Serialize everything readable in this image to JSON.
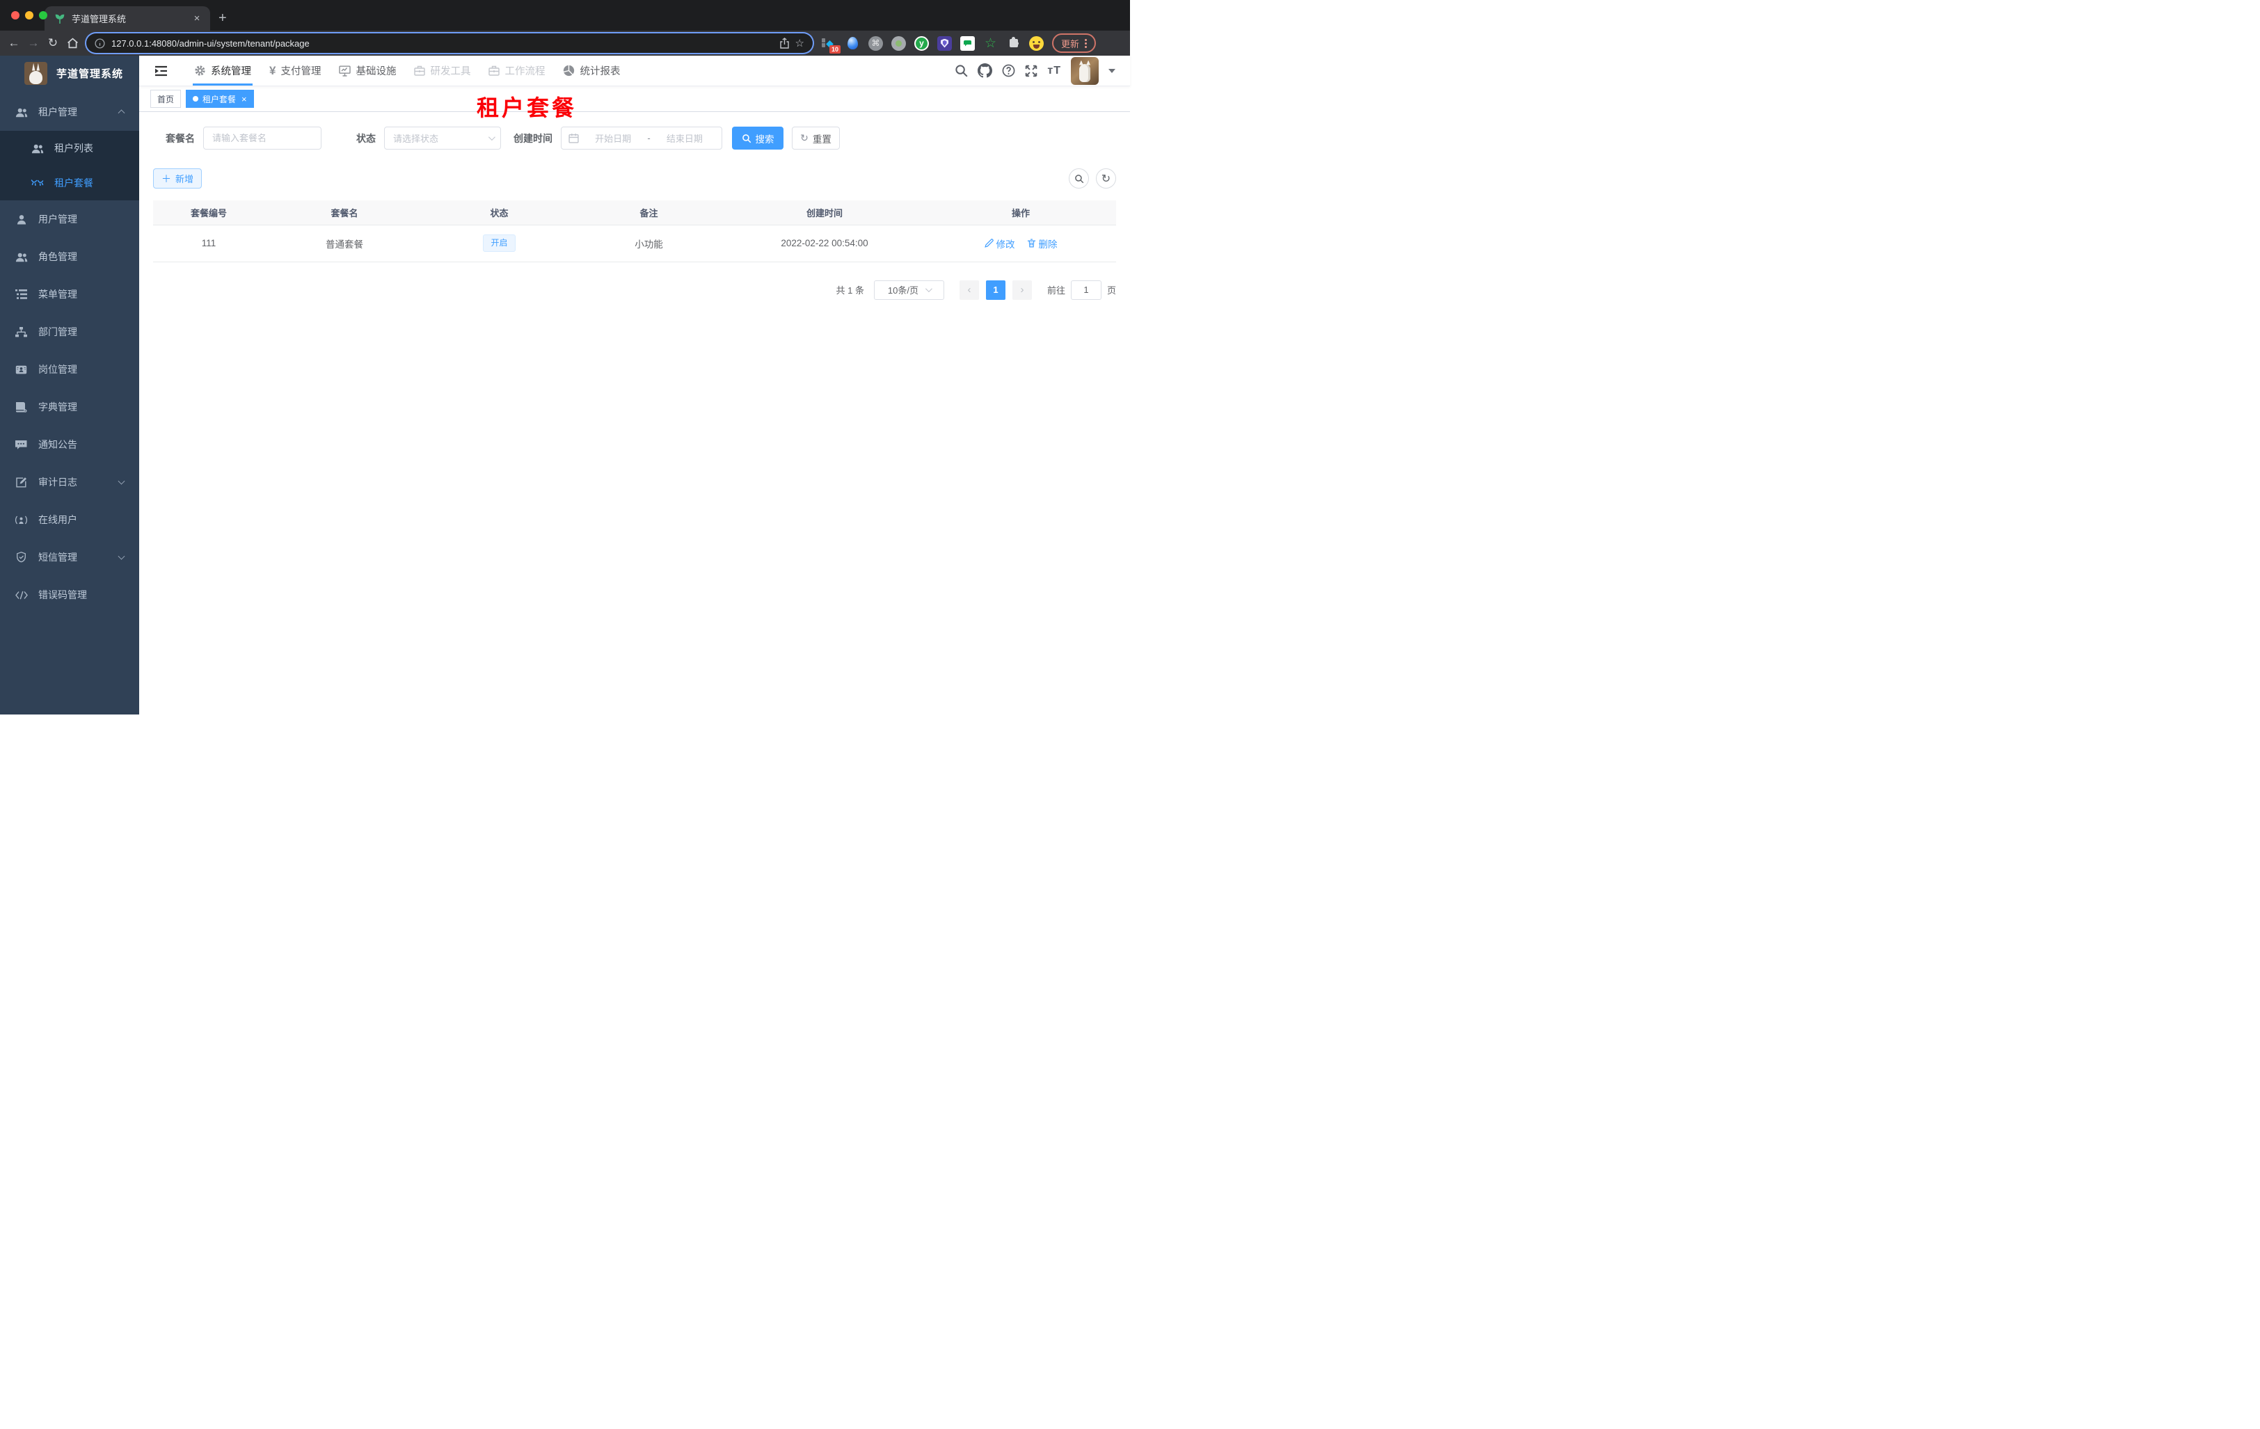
{
  "browser": {
    "tab": {
      "title": "芋道管理系统"
    },
    "url": "127.0.0.1:48080/admin-ui/system/tenant/package",
    "update_label": "更新",
    "extensions": [
      {
        "icon": "tampermonkey-extension-icon",
        "badge": "10"
      },
      {
        "icon": "gem-extension-icon"
      },
      {
        "icon": "command-extension-icon"
      },
      {
        "icon": "record-extension-icon"
      },
      {
        "icon": "y-extension-icon"
      },
      {
        "icon": "shield-extension-icon"
      },
      {
        "icon": "chat-extension-icon"
      },
      {
        "icon": "star-extension-icon"
      },
      {
        "icon": "puzzle-extension-icon"
      },
      {
        "icon": "emoji-extension-icon"
      }
    ]
  },
  "sidebar": {
    "logo_title": "芋道管理系统",
    "items": [
      {
        "label": "租户管理",
        "icon": "users-icon",
        "chevron": "up"
      },
      {
        "label": "租户列表",
        "icon": "users-icon",
        "sub": true
      },
      {
        "label": "租户套餐",
        "icon": "glasses-icon",
        "sub": true,
        "active": true
      },
      {
        "label": "用户管理",
        "icon": "user-icon"
      },
      {
        "label": "角色管理",
        "icon": "users-icon"
      },
      {
        "label": "菜单管理",
        "icon": "menu-tree-icon"
      },
      {
        "label": "部门管理",
        "icon": "org-icon"
      },
      {
        "label": "岗位管理",
        "icon": "badge-icon"
      },
      {
        "label": "字典管理",
        "icon": "book-icon"
      },
      {
        "label": "通知公告",
        "icon": "chat-bubble-icon"
      },
      {
        "label": "审计日志",
        "icon": "edit-note-icon",
        "chevron": "down"
      },
      {
        "label": "在线用户",
        "icon": "online-user-icon"
      },
      {
        "label": "短信管理",
        "icon": "shield-check-icon",
        "chevron": "down"
      },
      {
        "label": "错误码管理",
        "icon": "code-icon"
      }
    ]
  },
  "header": {
    "nav": [
      {
        "label": "系统管理",
        "icon": "gear-icon",
        "active": true
      },
      {
        "label": "支付管理",
        "icon": "yen-icon"
      },
      {
        "label": "基础设施",
        "icon": "monitor-icon"
      },
      {
        "label": "研发工具",
        "icon": "briefcase-icon",
        "dim": true
      },
      {
        "label": "工作流程",
        "icon": "briefcase-icon",
        "dim": true
      },
      {
        "label": "统计报表",
        "icon": "dashboard-icon"
      }
    ]
  },
  "tags": [
    {
      "label": "首页"
    },
    {
      "label": "租户套餐",
      "active": true
    }
  ],
  "annotation": "租户套餐",
  "filters": {
    "name_label": "套餐名",
    "name_placeholder": "请输入套餐名",
    "status_label": "状态",
    "status_placeholder": "请选择状态",
    "date_label": "创建时间",
    "date_start": "开始日期",
    "date_sep": "-",
    "date_end": "结束日期",
    "search_label": "搜索",
    "reset_label": "重置"
  },
  "toolbar": {
    "add_label": "新增"
  },
  "table": {
    "headers": [
      "套餐编号",
      "套餐名",
      "状态",
      "备注",
      "创建时间",
      "操作"
    ],
    "rows": [
      {
        "id": "111",
        "name": "普通套餐",
        "status": "开启",
        "remark": "小功能",
        "created": "2022-02-22 00:54:00",
        "edit": "修改",
        "delete": "删除"
      }
    ]
  },
  "pagination": {
    "total": "共 1 条",
    "page_size": "10条/页",
    "page": "1",
    "goto": "前往",
    "goto_value": "1",
    "unit": "页"
  }
}
